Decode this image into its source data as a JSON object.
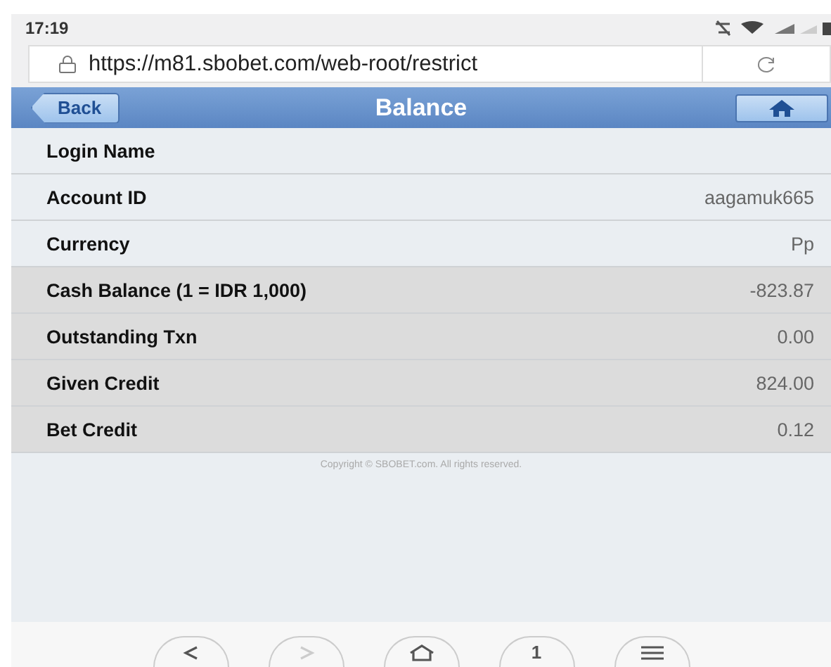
{
  "status_bar": {
    "time": "17:19"
  },
  "address_bar": {
    "url": "https://m81.sbobet.com/web-root/restrict"
  },
  "header": {
    "back": "Back",
    "title": "Balance"
  },
  "rows": [
    {
      "label": "Login Name",
      "shaded": false
    },
    {
      "label": "Account ID",
      "value": "aagamuk665",
      "shaded": false
    },
    {
      "label": "Currency",
      "value": "Pp",
      "shaded": false
    },
    {
      "label": "Cash Balance (1 = IDR 1,000)",
      "value": "-823.87",
      "shaded": true
    },
    {
      "label": "Outstanding Txn",
      "value": "0.00",
      "shaded": true
    },
    {
      "label": "Given Credit",
      "value": "824.00",
      "shaded": true
    },
    {
      "label": "Bet Credit",
      "value": "0.12",
      "shaded": true
    }
  ],
  "copyright": "Copyright © SBOBET.com. All rights reserved.",
  "browser_nav": [
    {
      "kind": "back",
      "disabled": false
    },
    {
      "kind": "forward",
      "disabled": true
    },
    {
      "kind": "home",
      "disabled": false
    },
    {
      "kind": "tabs",
      "count": "1",
      "disabled": false
    },
    {
      "kind": "menu",
      "disabled": false
    }
  ]
}
